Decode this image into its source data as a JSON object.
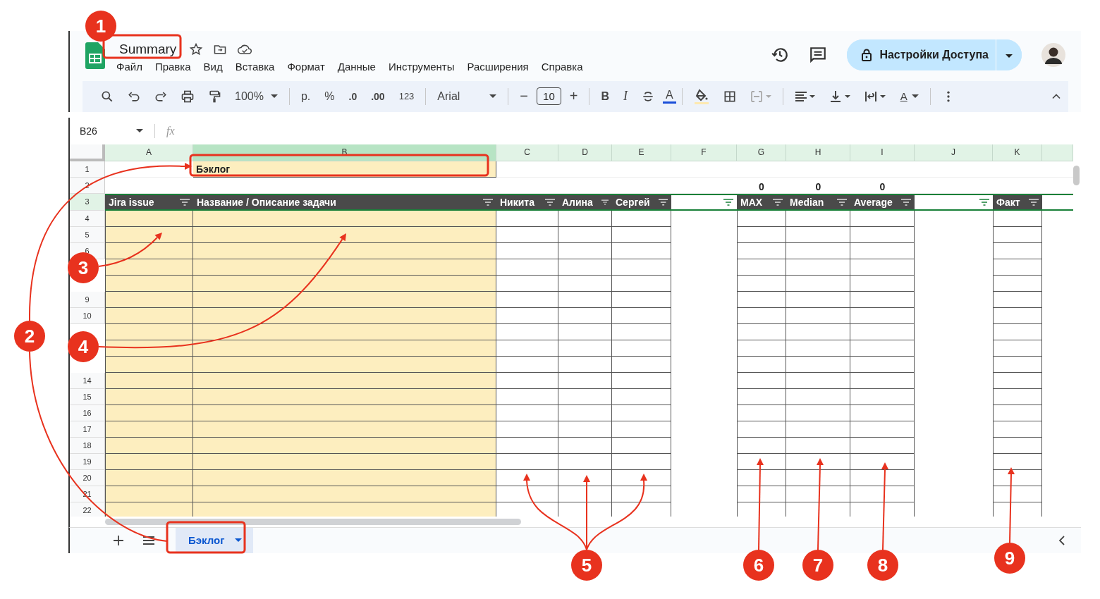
{
  "doc": {
    "title": "Summary"
  },
  "menu": [
    "Файл",
    "Правка",
    "Вид",
    "Вставка",
    "Формат",
    "Данные",
    "Инструменты",
    "Расширения",
    "Справка"
  ],
  "share_button": {
    "label": "Настройки Доступа"
  },
  "toolbar": {
    "zoom": "100%",
    "currency": "р.",
    "percent": "%",
    "decrease_decimals": ".0",
    "increase_decimals": ".00",
    "number_format": "123",
    "font": "Arial",
    "size_minus": "−",
    "font_size": "10",
    "size_plus": "+",
    "bold": "B",
    "italic": "I",
    "text_color": "A",
    "rotate": "A"
  },
  "formula_bar": {
    "name_box": "B26",
    "fx": "fx"
  },
  "columns": [
    {
      "label": "A",
      "selected": false,
      "kind": "backlog"
    },
    {
      "label": "B",
      "selected": true,
      "kind": "backlog"
    },
    {
      "label": "C",
      "selected": false,
      "kind": "grid"
    },
    {
      "label": "D",
      "selected": false,
      "kind": "grid"
    },
    {
      "label": "E",
      "selected": false,
      "kind": "grid"
    },
    {
      "label": "F",
      "selected": false,
      "kind": "gap"
    },
    {
      "label": "G",
      "selected": false,
      "kind": "grid"
    },
    {
      "label": "H",
      "selected": false,
      "kind": "grid"
    },
    {
      "label": "I",
      "selected": false,
      "kind": "grid"
    },
    {
      "label": "J",
      "selected": false,
      "kind": "gap"
    },
    {
      "label": "K",
      "selected": false,
      "kind": "grid"
    }
  ],
  "title_cell": {
    "text": "Бэклог"
  },
  "totals": [
    "0",
    "0",
    "0"
  ],
  "header_cells": [
    {
      "kind": "dark",
      "text": "Jira issue"
    },
    {
      "kind": "dark",
      "text": "Название / Описание задачи"
    },
    {
      "kind": "dark",
      "text": "Никита"
    },
    {
      "kind": "dark",
      "text": "Алина"
    },
    {
      "kind": "dark",
      "text": "Сергей"
    },
    {
      "kind": "blank"
    },
    {
      "kind": "dark",
      "text": "MAX"
    },
    {
      "kind": "dark",
      "text": "Median"
    },
    {
      "kind": "dark",
      "text": "Average"
    },
    {
      "kind": "blank"
    },
    {
      "kind": "dark",
      "text": "Факт"
    }
  ],
  "top_rows": [
    {
      "number": "1",
      "selected": false
    },
    {
      "number": "2",
      "selected": false
    },
    {
      "number": "3",
      "selected": true
    }
  ],
  "rows": [
    {
      "number": "4"
    },
    {
      "number": "5"
    },
    {
      "number": "6"
    },
    {},
    {},
    {
      "number": "9"
    },
    {
      "number": "10"
    },
    {},
    {},
    {},
    {
      "number": "14"
    },
    {
      "number": "15"
    },
    {
      "number": "16"
    },
    {
      "number": "17"
    },
    {
      "number": "18"
    },
    {
      "number": "19"
    },
    {
      "number": "20"
    },
    {
      "number": "21"
    },
    {
      "number": "22"
    }
  ],
  "sheet_tabs": [
    {
      "label": "Бэклог",
      "selected": true
    }
  ],
  "callouts": [
    "1",
    "2",
    "3",
    "4",
    "5",
    "6",
    "7",
    "8",
    "9"
  ]
}
